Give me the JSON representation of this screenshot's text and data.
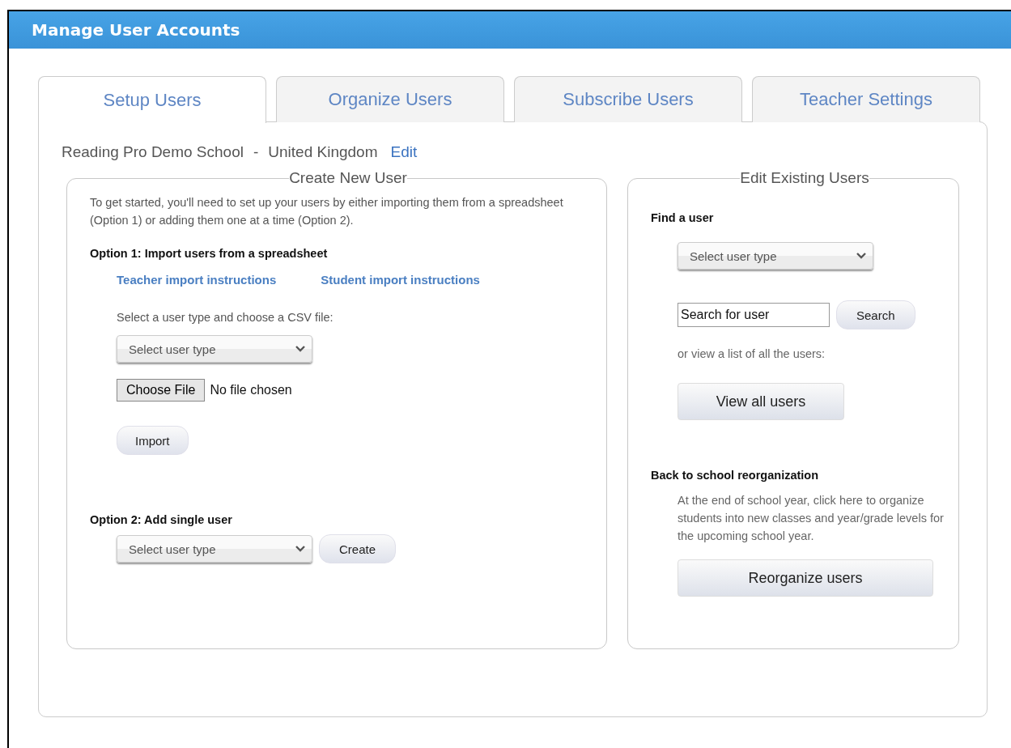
{
  "window": {
    "title": "Manage User Accounts"
  },
  "tabs": [
    {
      "label": "Setup Users",
      "selected": true
    },
    {
      "label": "Organize Users",
      "selected": false
    },
    {
      "label": "Subscribe Users",
      "selected": false
    },
    {
      "label": "Teacher Settings",
      "selected": false
    }
  ],
  "school": {
    "name": "Reading Pro Demo School",
    "separator": "-",
    "country": "United Kingdom",
    "edit_link": "Edit"
  },
  "create_section": {
    "title": "Create New User",
    "intro": "To get started, you'll need to set up your users by either importing them from a spreadsheet (Option 1) or adding them one at a time (Option 2).",
    "option1": {
      "heading": "Option 1: Import users from a spreadsheet",
      "links": [
        "Teacher import instructions",
        "Student import instructions"
      ],
      "instruction": "Select a user type and choose a CSV file:",
      "select": "Select user type",
      "file_button": "Choose File",
      "file_status": "No file chosen",
      "import_button": "Import"
    },
    "option2": {
      "heading": "Option 2: Add single user",
      "select": "Select user type",
      "create_button": "Create"
    }
  },
  "edit_section": {
    "title": "Edit Existing Users",
    "find_heading": "Find a user",
    "select": "Select user type",
    "search_field": {
      "value": "Search for user"
    },
    "search_button": "Search",
    "view_all_text": "or view a list of all the users:",
    "view_all_button": "View all users",
    "reorg_heading": "Back to school reorganization",
    "reorg_text": "At the end of school year, click here to organize students into new classes and year/grade levels for the upcoming school year.",
    "reorg_button": "Reorganize users"
  }
}
